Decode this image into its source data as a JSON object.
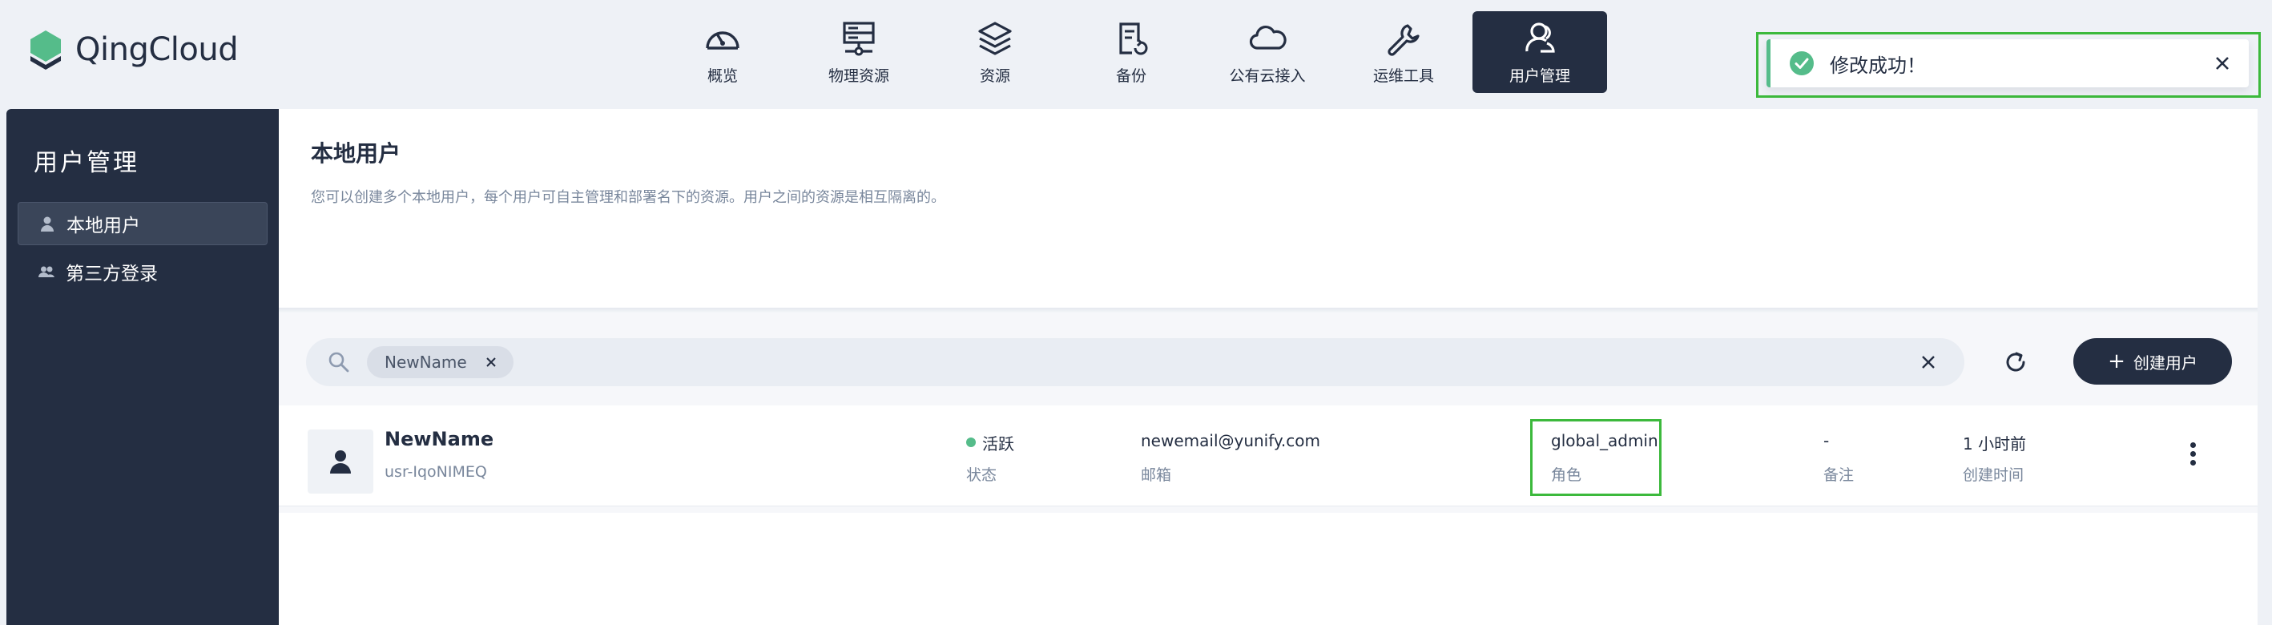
{
  "app": {
    "brand": "QingCloud",
    "brand_color": "#55bc8a",
    "dark_color": "#242e42"
  },
  "nav": {
    "items": [
      {
        "label": "概览",
        "icon": "dashboard-gauge-icon"
      },
      {
        "label": "物理资源",
        "icon": "server-icon"
      },
      {
        "label": "资源",
        "icon": "layers-icon"
      },
      {
        "label": "备份",
        "icon": "backup-icon"
      },
      {
        "label": "公有云接入",
        "icon": "cloud-icon"
      },
      {
        "label": "运维工具",
        "icon": "wrench-icon"
      },
      {
        "label": "用户管理",
        "icon": "users-icon",
        "active": true
      }
    ]
  },
  "toast": {
    "message": "修改成功！",
    "status_color": "#55bc8a"
  },
  "sidebar": {
    "title": "用户管理",
    "items": [
      {
        "label": "本地用户",
        "icon": "user-icon",
        "active": true
      },
      {
        "label": "第三方登录",
        "icon": "users-icon"
      }
    ]
  },
  "page": {
    "title": "本地用户",
    "description": "您可以创建多个本地用户，每个用户可自主管理和部署名下的资源。用户之间的资源是相互隔离的。"
  },
  "toolbar": {
    "search_chip": "NewName",
    "create_button": "创建用户"
  },
  "users": [
    {
      "name": "NewName",
      "id": "usr-IqoNIMEQ",
      "status": "活跃",
      "status_label": "状态",
      "email": "newemail@yunify.com",
      "email_label": "邮箱",
      "role": "global_admin",
      "role_label": "角色",
      "remark": "-",
      "remark_label": "备注",
      "created": "1 小时前",
      "created_label": "创建时间"
    }
  ]
}
